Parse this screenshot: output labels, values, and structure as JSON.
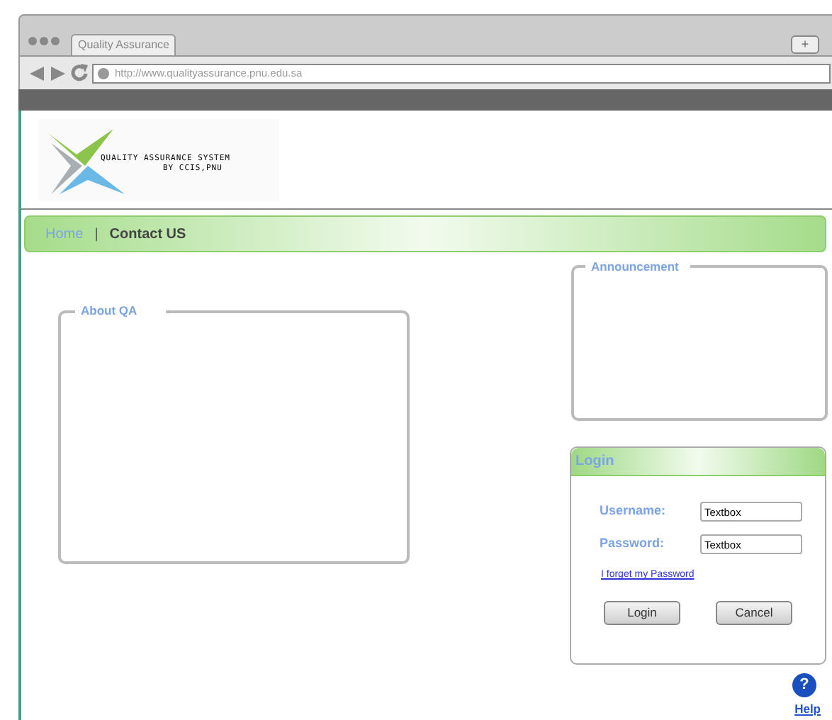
{
  "browser": {
    "tab_title": "Quality Assurance",
    "new_tab": "+",
    "url": "http://www.qualityassurance.pnu.edu.sa"
  },
  "logo": {
    "line1": "QUALITY ASSURANCE SYSTEM",
    "line2": "BY CCIS,PNU"
  },
  "nav": {
    "items": [
      {
        "label": "Home",
        "selected": true
      },
      {
        "label": "Contact US",
        "selected": false
      }
    ],
    "separator": "|"
  },
  "about": {
    "legend": "About QA"
  },
  "announcement": {
    "legend": "Announcement"
  },
  "login": {
    "title": "Login",
    "fields": [
      {
        "label": "Username:",
        "value": "Textbox"
      },
      {
        "label": "Password:",
        "value": "Textbox"
      }
    ],
    "forgot_link": "I forget my Password",
    "buttons": [
      "Login",
      "Cancel"
    ]
  },
  "help": {
    "label": "Help",
    "icon": "?"
  }
}
